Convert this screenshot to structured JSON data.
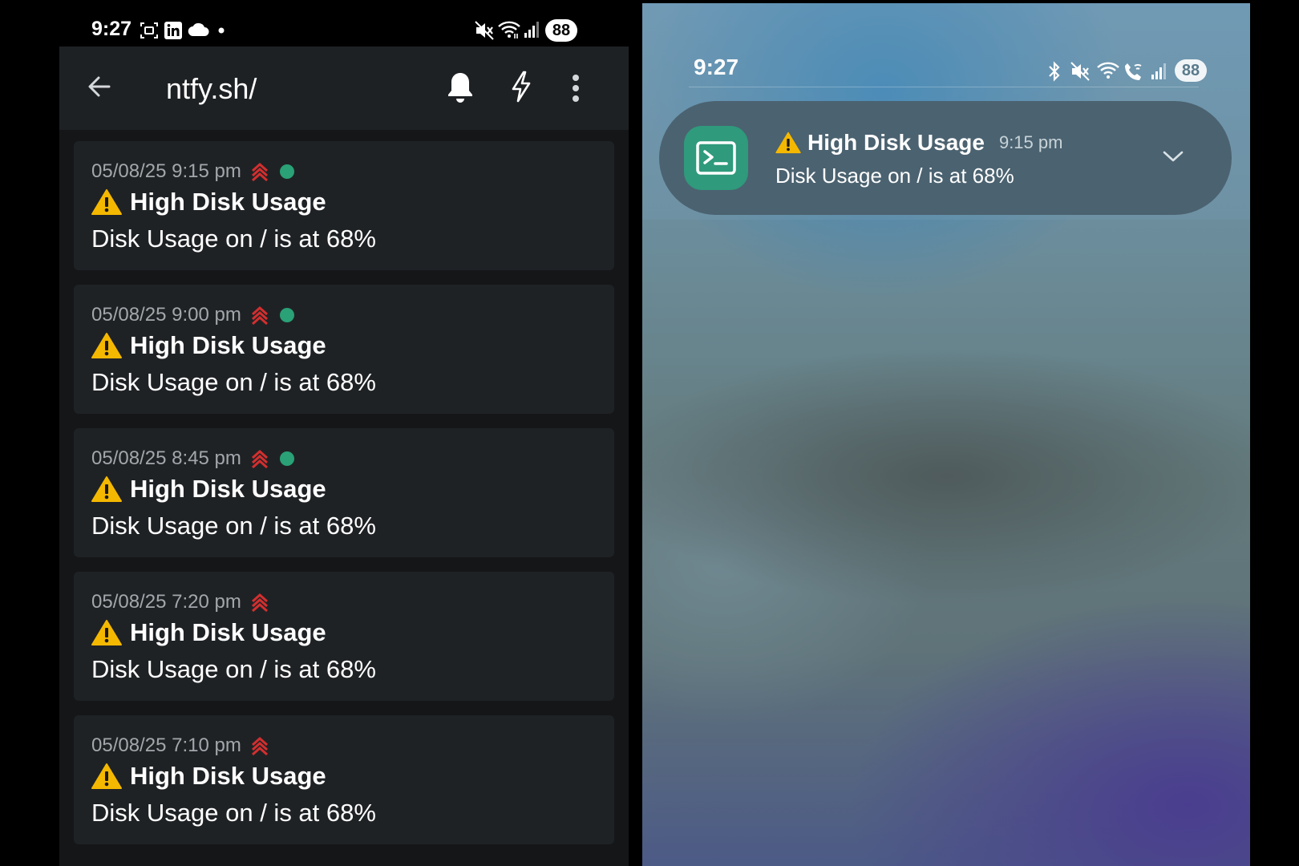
{
  "left_phone": {
    "status_bar": {
      "time": "9:27",
      "battery": "88"
    },
    "app_bar": {
      "title": "ntfy.sh/"
    },
    "notifications": [
      {
        "timestamp": "05/08/25 9:15 pm",
        "title": "High Disk Usage",
        "message": "Disk Usage on / is at 68%",
        "new": true
      },
      {
        "timestamp": "05/08/25 9:00 pm",
        "title": "High Disk Usage",
        "message": "Disk Usage on / is at 68%",
        "new": true
      },
      {
        "timestamp": "05/08/25 8:45 pm",
        "title": "High Disk Usage",
        "message": "Disk Usage on / is at 68%",
        "new": true
      },
      {
        "timestamp": "05/08/25 7:20 pm",
        "title": "High Disk Usage",
        "message": "Disk Usage on / is at 68%",
        "new": false
      },
      {
        "timestamp": "05/08/25 7:10 pm",
        "title": "High Disk Usage",
        "message": "Disk Usage on / is at 68%",
        "new": false
      }
    ],
    "icons": {
      "back": "arrow-left-icon",
      "subscribe": "bell-icon",
      "instant": "lightning-icon",
      "menu": "more-vertical-icon",
      "priority": "priority-high-icon",
      "warning": "warning-emoji-icon"
    }
  },
  "right_phone": {
    "status_bar": {
      "time": "9:27",
      "battery": "88"
    },
    "notification": {
      "title": "High Disk Usage",
      "time": "9:15 pm",
      "message": "Disk Usage on / is at 68%",
      "app_icon": "terminal-icon"
    }
  },
  "colors": {
    "app_bar_bg": "#1e2124",
    "card_bg": "#1f2225",
    "list_bg": "#141618",
    "priority_red": "#d32f2f",
    "new_dot": "#2aa176",
    "warning_yellow": "#f5b800",
    "notif_pill_bg": "#4b6270",
    "app_icon_bg": "#2f9a7c"
  }
}
